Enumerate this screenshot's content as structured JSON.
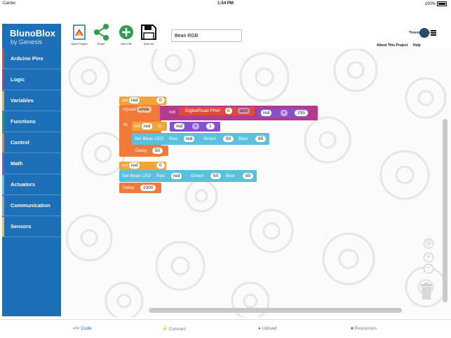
{
  "status": {
    "carrier": "Carrier",
    "time": "1:54 PM",
    "battery": "100%"
  },
  "toolbar": {
    "open_label": "Open Project",
    "share_label": "Share",
    "new_label": "New File",
    "save_label": "Save As",
    "project_name": "Bean RGB"
  },
  "user": {
    "name": "Trevor Shaw"
  },
  "links": {
    "about": "About This Project",
    "help": "Help"
  },
  "sidebar": {
    "brand": "BlunoBlox",
    "brand_sub": "by Genesis",
    "items": [
      {
        "label": "Arduino Pins",
        "color": "#e04a3a"
      },
      {
        "label": "Logic",
        "color": "#b23c8a"
      },
      {
        "label": "Variables",
        "color": "#f2a43a"
      },
      {
        "label": "Functions",
        "color": "#2f9e4a"
      },
      {
        "label": "Control",
        "color": "#f07a3a"
      },
      {
        "label": "Math",
        "color": "#8a4fd0"
      },
      {
        "label": "Actuators",
        "color": "#5bc0de"
      },
      {
        "label": "Communication",
        "color": "#9aa4ad"
      },
      {
        "label": "Sensors",
        "color": "#f0c030"
      }
    ]
  },
  "blocks": {
    "set": "set",
    "to": "to",
    "var_red": "red",
    "zero": "0",
    "repeat_while": "repeat",
    "while_opt": "while",
    "not": "not",
    "digital_read": "DigitalRead PIN#",
    "pin0": "0",
    "and": "and",
    "lt": "<",
    "val255": "255",
    "do": "do",
    "plus": "+",
    "one": "1",
    "set_bean_led": "Set Bean LED",
    "red_lbl": "Red",
    "green_lbl": "Green",
    "blue_lbl": "Blue",
    "green_val": "50",
    "blue_val": "85",
    "delay": "Delay",
    "delay_val1": "50",
    "delay_val2": "1000"
  },
  "tabs": [
    {
      "label": "Code",
      "icon": "code-icon"
    },
    {
      "label": "Connect",
      "icon": "connect-icon"
    },
    {
      "label": "Upload",
      "icon": "upload-icon"
    },
    {
      "label": "Resources",
      "icon": "resources-icon"
    }
  ],
  "colors": {
    "sidebar_bg": "#1d6fb7",
    "variables": "#f2a43a",
    "control": "#f07a3a",
    "logic": "#b23c8a",
    "pins": "#e04a3a",
    "math": "#8a4fd0",
    "actuators": "#5bc0de"
  }
}
